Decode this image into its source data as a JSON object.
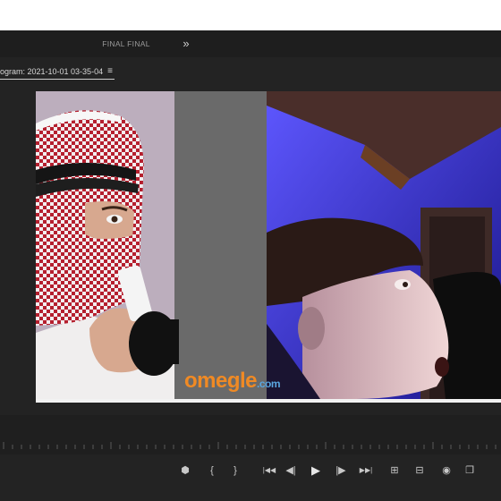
{
  "workspace": {
    "tab_label": "FINAL FINAL",
    "more_icon": "chevron-double-right-icon"
  },
  "program_monitor": {
    "tab_label": "ogram: 2021-10-01 03-35-04",
    "menu_icon": "hamburger-menu-icon"
  },
  "video": {
    "watermark_main": "omegle",
    "watermark_suffix": ".com",
    "watermark_color": "#f08a24",
    "watermark_suffix_color": "#5aa6e0"
  },
  "controls": [
    {
      "name": "add-marker-button",
      "glyph": "⬢"
    },
    {
      "name": "mark-in-button",
      "glyph": "{"
    },
    {
      "name": "mark-out-button",
      "glyph": "}"
    },
    {
      "name": "go-to-in-button",
      "glyph": "|◀◀"
    },
    {
      "name": "step-back-button",
      "glyph": "◀|"
    },
    {
      "name": "play-button",
      "glyph": "▶"
    },
    {
      "name": "step-forward-button",
      "glyph": "|▶"
    },
    {
      "name": "go-to-out-button",
      "glyph": "▶▶|"
    },
    {
      "name": "lift-button",
      "glyph": "⊞"
    },
    {
      "name": "extract-button",
      "glyph": "⊟"
    },
    {
      "name": "export-frame-button",
      "glyph": "◉"
    },
    {
      "name": "comparison-view-button",
      "glyph": "❐"
    }
  ],
  "colors": {
    "panel_bg": "#232323",
    "workspace_bg": "#1e1e1e",
    "text": "#d6d6d6"
  }
}
